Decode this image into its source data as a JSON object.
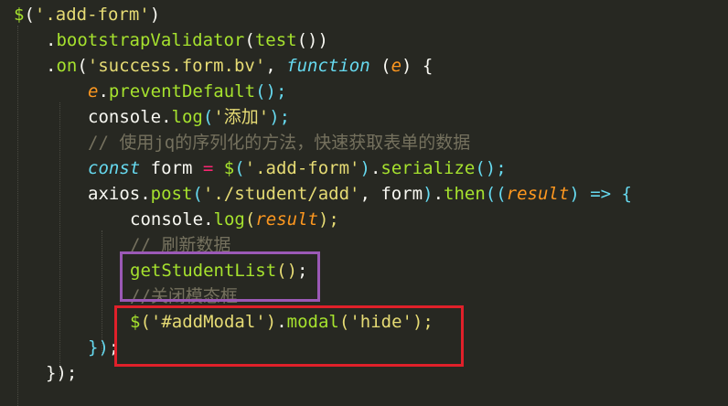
{
  "editor": {
    "theme_colors": {
      "background": "#272822",
      "function": "#a6e22e",
      "string": "#e6db74",
      "keyword": "#66d9ef",
      "parameter": "#fd971f",
      "operator": "#f92672",
      "comment": "#75715e",
      "plain": "#f8f8f2",
      "purple_box": "#9b59b6",
      "red_box": "#e0202a"
    },
    "lines": [
      [
        [
          "$",
          "fn"
        ],
        [
          "(",
          "br1"
        ],
        [
          "'.add-form'",
          "str"
        ],
        [
          ")",
          "br1"
        ]
      ],
      [
        [
          ".",
          "plain"
        ],
        [
          "bootstrapValidator",
          "fn"
        ],
        [
          "(",
          "br1"
        ],
        [
          "test",
          "fn"
        ],
        [
          "())",
          "br1"
        ]
      ],
      [
        [
          ".",
          "plain"
        ],
        [
          "on",
          "fn"
        ],
        [
          "(",
          "br1"
        ],
        [
          "'success.form.bv'",
          "str"
        ],
        [
          ", ",
          "plain"
        ],
        [
          "function",
          "kw"
        ],
        [
          " (",
          "plain"
        ],
        [
          "e",
          "param"
        ],
        [
          ") {",
          "br1"
        ]
      ],
      [
        [
          "e",
          "param"
        ],
        [
          ".",
          "plain"
        ],
        [
          "preventDefault",
          "fn"
        ],
        [
          "();",
          "br2"
        ]
      ],
      [
        [
          "console",
          "plain"
        ],
        [
          ".",
          "plain"
        ],
        [
          "log",
          "fn"
        ],
        [
          "(",
          "br2"
        ],
        [
          "'添加'",
          "str"
        ],
        [
          ");",
          "br2"
        ]
      ],
      [
        [
          "// 使用jq的序列化的方法，快速获取表单的数据",
          "cmt"
        ]
      ],
      [
        [
          "const",
          "kw"
        ],
        [
          " form ",
          "plain"
        ],
        [
          "=",
          "op"
        ],
        [
          " ",
          "plain"
        ],
        [
          "$",
          "fn"
        ],
        [
          "(",
          "br2"
        ],
        [
          "'.add-form'",
          "str"
        ],
        [
          ")",
          "br2"
        ],
        [
          ".",
          "plain"
        ],
        [
          "serialize",
          "fn"
        ],
        [
          "();",
          "br2"
        ]
      ],
      [
        [
          "axios",
          "plain"
        ],
        [
          ".",
          "plain"
        ],
        [
          "post",
          "fn"
        ],
        [
          "(",
          "br2"
        ],
        [
          "'./student/add'",
          "str"
        ],
        [
          ", form",
          "plain"
        ],
        [
          ")",
          "br2"
        ],
        [
          ".",
          "plain"
        ],
        [
          "then",
          "fn"
        ],
        [
          "((",
          "br2"
        ],
        [
          "result",
          "param"
        ],
        [
          ") ",
          "br2"
        ],
        [
          "=>",
          "kw"
        ],
        [
          " {",
          "br2"
        ]
      ],
      [
        [
          "console",
          "plain"
        ],
        [
          ".",
          "plain"
        ],
        [
          "log",
          "fn"
        ],
        [
          "(",
          "br3"
        ],
        [
          "result",
          "param"
        ],
        [
          ");",
          "br3"
        ]
      ],
      [
        [
          "// 刷新数据",
          "cmt"
        ]
      ],
      [
        [
          "getStudentList",
          "fn"
        ],
        [
          "()",
          "br3"
        ],
        [
          ";",
          "plain"
        ]
      ],
      [
        [
          "//关闭模态框",
          "cmt"
        ]
      ],
      [
        [
          "$",
          "fn"
        ],
        [
          "(",
          "br3"
        ],
        [
          "'#addModal'",
          "str"
        ],
        [
          ")",
          "br3"
        ],
        [
          ".",
          "plain"
        ],
        [
          "modal",
          "fn"
        ],
        [
          "(",
          "br3"
        ],
        [
          "'hide'",
          "str"
        ],
        [
          ");",
          "br3"
        ]
      ],
      [
        [
          "})",
          "br2"
        ],
        [
          ";",
          "plain"
        ]
      ],
      [
        [
          "});",
          "br1"
        ]
      ]
    ],
    "indent": [
      1,
      4,
      4,
      8,
      8,
      8,
      8,
      8,
      12,
      12,
      12,
      12,
      12,
      8,
      4
    ]
  }
}
